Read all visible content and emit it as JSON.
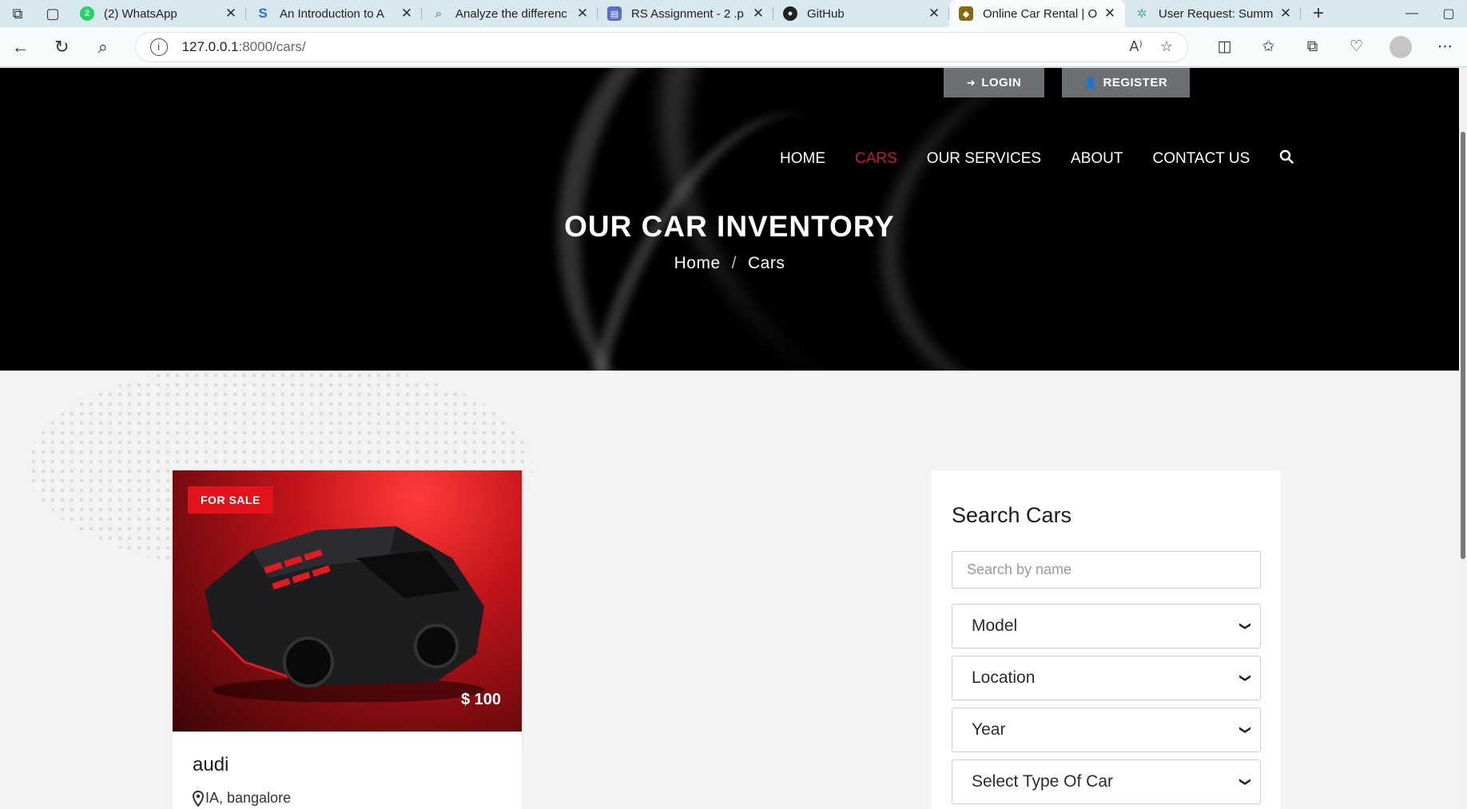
{
  "browser": {
    "tabs": [
      {
        "title": "(2) WhatsApp",
        "favicon": "whatsapp-icon",
        "color": "#25d366",
        "glyph": "2"
      },
      {
        "title": "An Introduction to A",
        "favicon": "s-icon",
        "color": "#2b6fe8",
        "glyph": "S"
      },
      {
        "title": "Analyze the differenc",
        "favicon": "search-icon",
        "color": "#8aa",
        "glyph": "⌕"
      },
      {
        "title": "RS Assignment - 2 .p",
        "favicon": "document-icon",
        "color": "#5b6ec7",
        "glyph": "▤"
      },
      {
        "title": "GitHub",
        "favicon": "github-icon",
        "color": "#222",
        "glyph": "●"
      },
      {
        "title": "Online Car Rental | O",
        "favicon": "car-rental-icon",
        "color": "#8a6a10",
        "glyph": "◆"
      },
      {
        "title": "User Request: Summ",
        "favicon": "openai-icon",
        "color": "#7aa",
        "glyph": "✲"
      }
    ],
    "active_tab": 5,
    "url_host": "127.0.0.1",
    "url_path": ":8000/cars/"
  },
  "header": {
    "login_label": "LOGIN",
    "register_label": "REGISTER",
    "nav": [
      "HOME",
      "CARS",
      "OUR SERVICES",
      "ABOUT",
      "CONTACT US"
    ],
    "active_nav": "CARS",
    "title": "OUR CAR INVENTORY",
    "breadcrumb": [
      "Home",
      "Cars"
    ]
  },
  "listing": {
    "badge": "FOR SALE",
    "price": "$ 100",
    "name": "audi",
    "location": "IA, bangalore"
  },
  "search": {
    "title": "Search Cars",
    "name_placeholder": "Search by name",
    "selects": [
      "Model",
      "Location",
      "Year",
      "Select Type Of Car"
    ]
  },
  "colors": {
    "accent": "#d3141d",
    "tabstrip": "#d7e8ef",
    "hero_bg": "#000000",
    "button_gray": "#6b7074"
  }
}
